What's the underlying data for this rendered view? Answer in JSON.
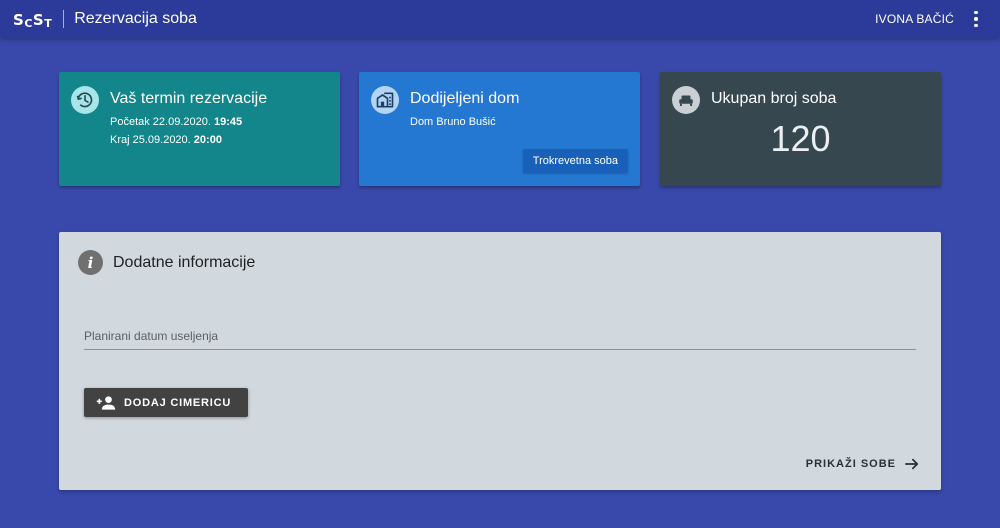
{
  "appbar": {
    "logo_main_1": "S",
    "logo_sub": "C",
    "logo_main_2": "S",
    "logo_sub_2": "T",
    "title": "Rezervacija soba",
    "user_name": "IVONA BAČIĆ",
    "more_icon": "more-vert-icon"
  },
  "cards": {
    "reservation": {
      "icon": "clock-icon",
      "title": "Vaš termin rezervacije",
      "start_label": "Početak 22.09.2020.",
      "start_time": "19:45",
      "end_label": "Kraj 25.09.2020.",
      "end_time": "20:00",
      "color": "#12868a"
    },
    "dorm": {
      "icon": "building-icon",
      "title": "Dodijeljeni dom",
      "dorm_name": "Dom Bruno Bušić",
      "room_type": "Trokrevetna soba",
      "color": "#2478d2"
    },
    "rooms": {
      "icon": "bed-icon",
      "title": "Ukupan broj soba",
      "count": "120",
      "color": "#37474f"
    }
  },
  "panel": {
    "icon": "info-icon",
    "title": "Dodatne informacije",
    "date_placeholder": "Planirani datum useljenja",
    "date_value": "",
    "add_roommate_icon": "person-add-icon",
    "add_roommate_label": "DODAJ CIMERICU",
    "show_rooms_label": "PRIKAŽI SOBE",
    "show_rooms_icon": "arrow-right-icon"
  },
  "colors": {
    "background": "#3949ab",
    "appbar": "#2c3a99",
    "panel": "#d1d9df"
  }
}
